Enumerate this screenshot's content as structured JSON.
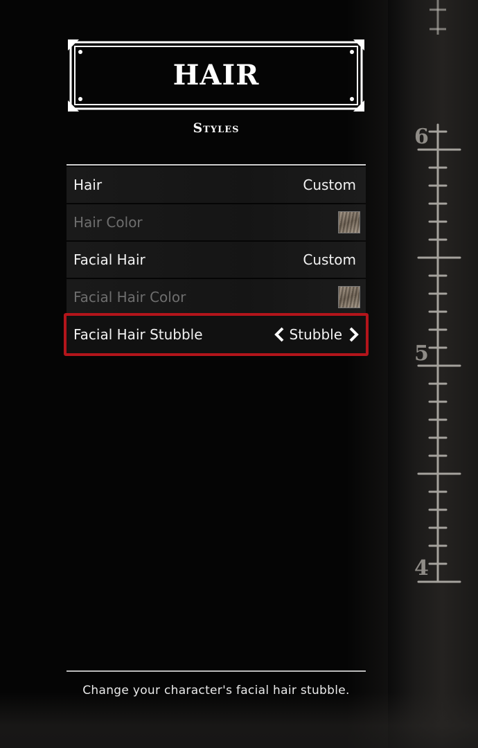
{
  "header": {
    "title": "HAIR",
    "subtitle": "Styles"
  },
  "options": [
    {
      "label": "Hair",
      "value": "Custom",
      "state": "enabled"
    },
    {
      "label": "Hair Color",
      "swatch": "hair-color-swatch",
      "state": "disabled"
    },
    {
      "label": "Facial Hair",
      "value": "Custom",
      "state": "enabled"
    },
    {
      "label": "Facial Hair Color",
      "swatch": "facial-hair-color-swatch",
      "state": "disabled"
    },
    {
      "label": "Facial Hair Stubble",
      "value": "Stubble",
      "state": "selected"
    }
  ],
  "help": {
    "text": "Change your character's facial hair stubble."
  },
  "ruler": {
    "marks": [
      "6",
      "5",
      "4"
    ]
  },
  "colors": {
    "selection_border": "#b3151b",
    "accent_text": "#ffffff",
    "disabled_text": "#6e6e6e"
  },
  "icons": {
    "left": "chevron-left-icon",
    "right": "chevron-right-icon"
  }
}
